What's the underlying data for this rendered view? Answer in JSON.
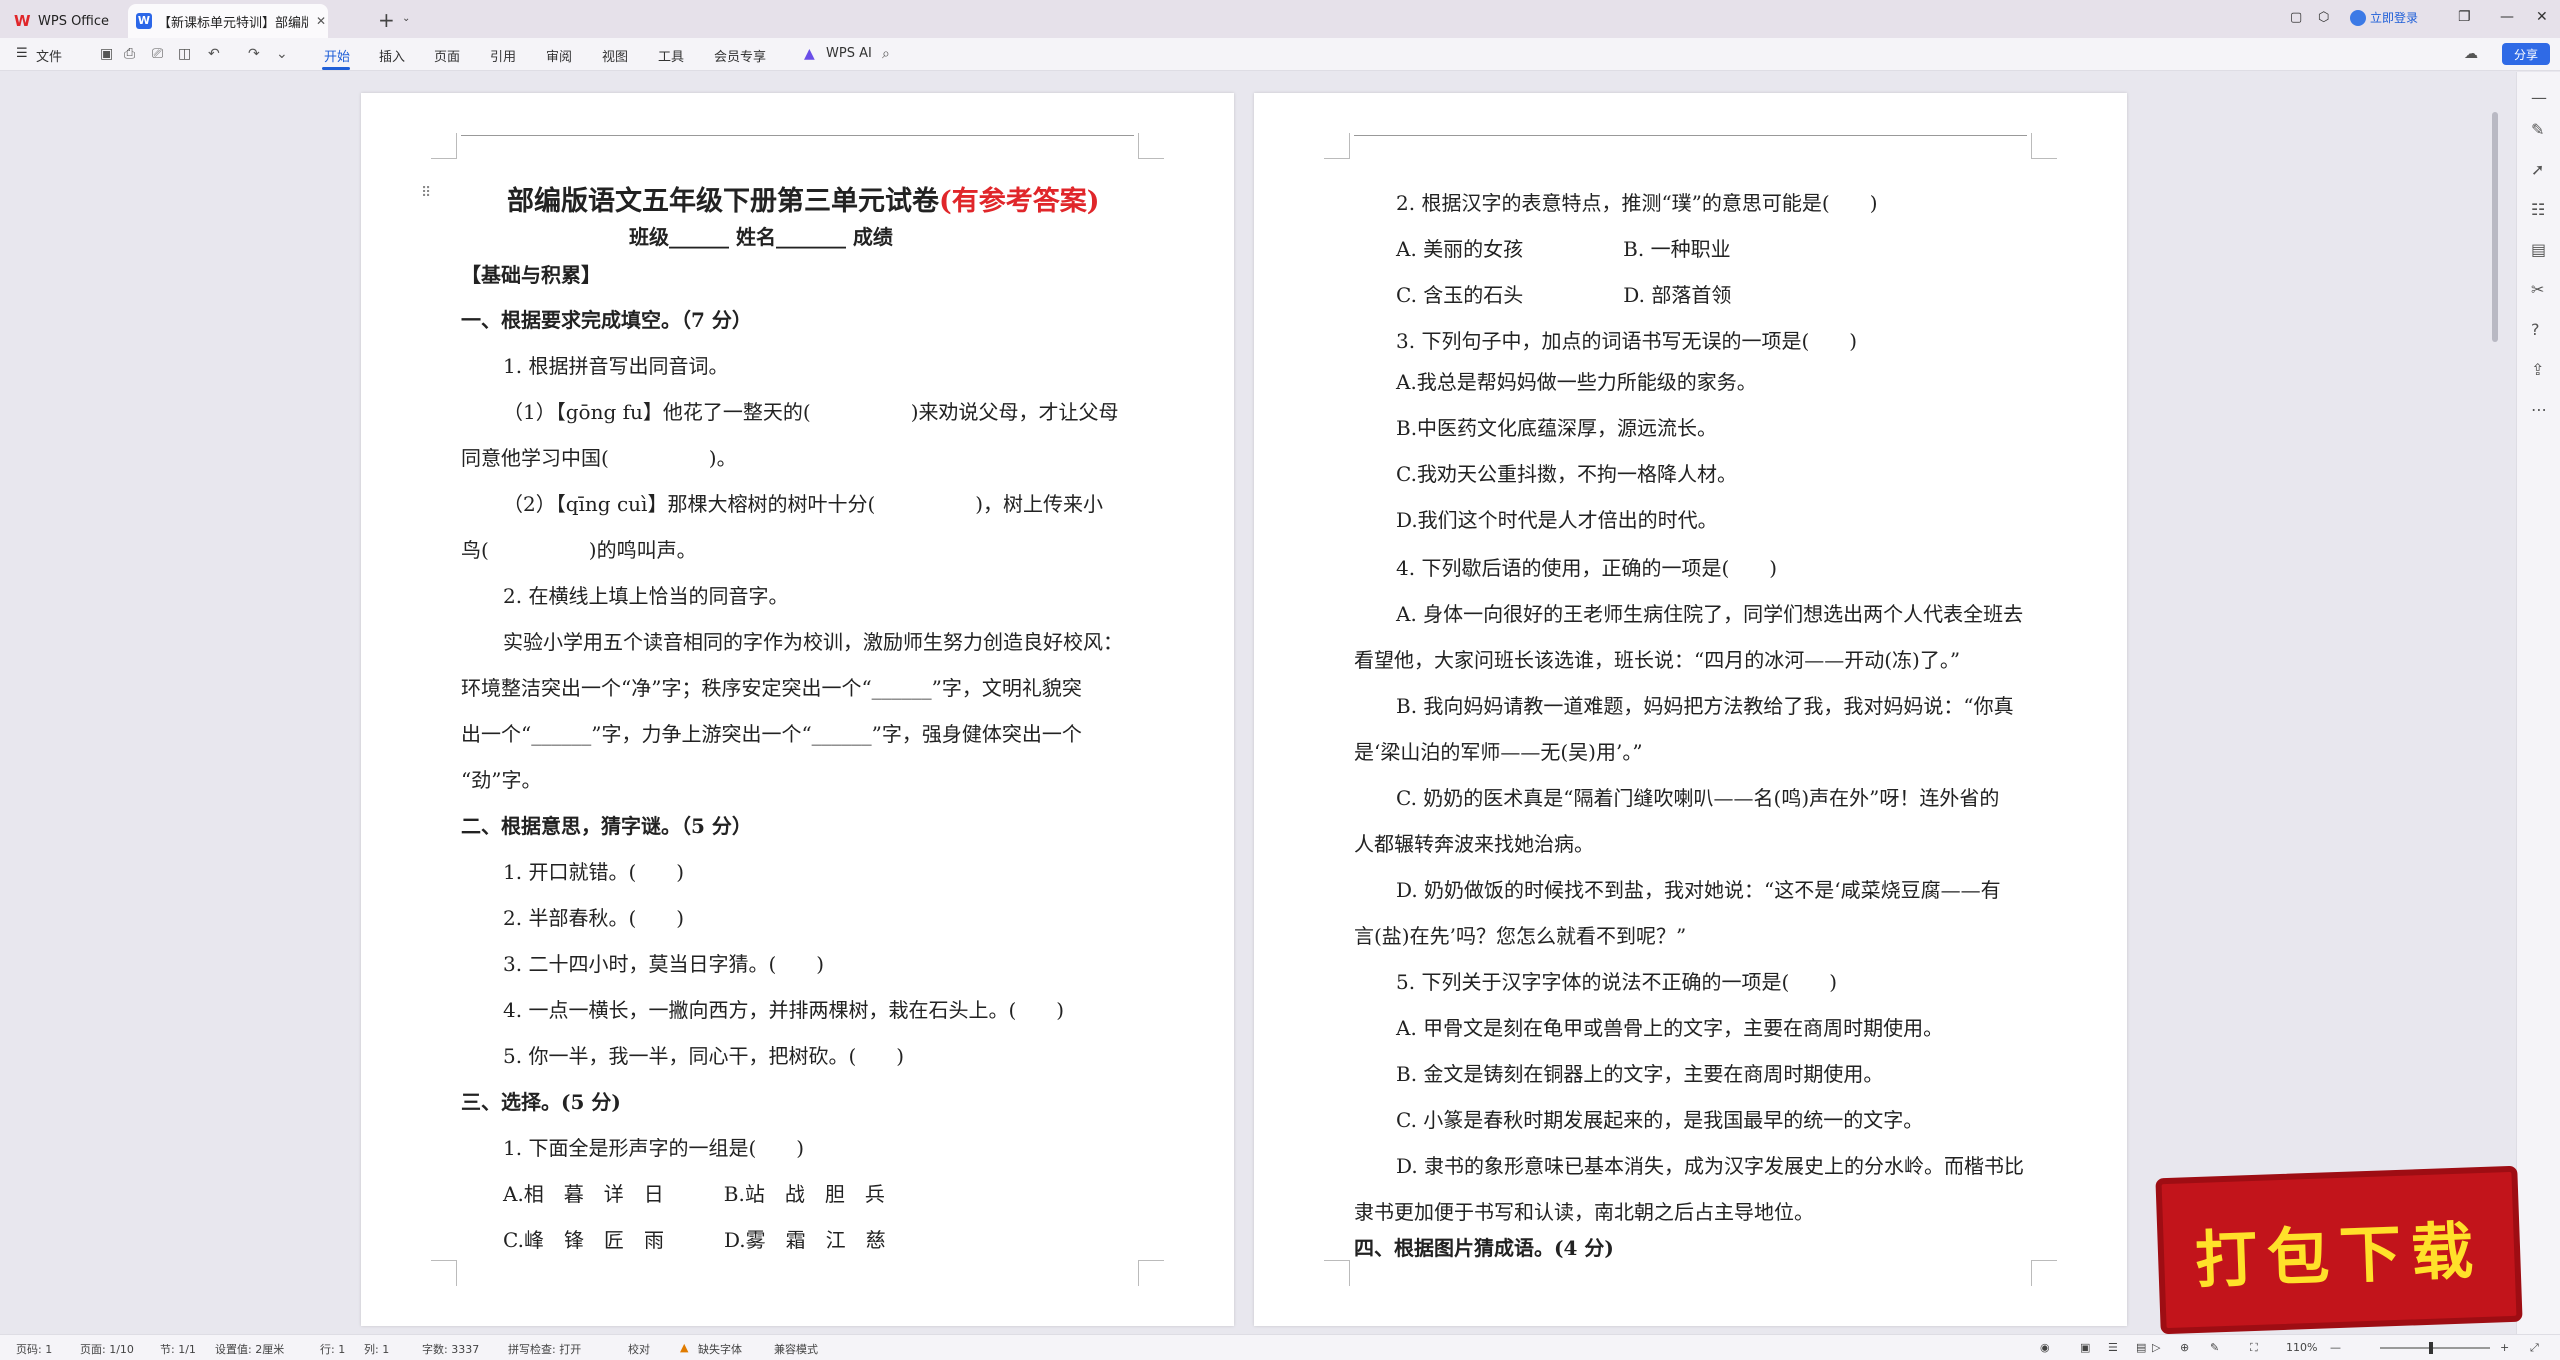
{
  "titlebar": {
    "app_tab": "WPS Office",
    "doc_tab": "【新课标单元特训】部编版语",
    "login": "立即登录"
  },
  "toolbar": {
    "file": "文件",
    "tabs": [
      "开始",
      "插入",
      "页面",
      "引用",
      "审阅",
      "视图",
      "工具",
      "会员专享"
    ],
    "ai": "WPS AI",
    "share": "分享"
  },
  "page1": {
    "title_main": "部编版语文五年级下册第三单元试卷",
    "title_red": "(有参考答案)",
    "subtitle": "班级______  姓名_______  成绩",
    "lines": [
      "【基础与积累】",
      "一、根据要求完成填空。（7 分）",
      "1. 根据拼音写出同音词。",
      "（1）【gōng fu】他花了一整天的(　　　　　)来劝说父母，才让父母",
      "同意他学习中国(　　　　　)。",
      "（2）【qīng cuì】那棵大榕树的树叶十分(　　　　　)，树上传来小",
      "鸟(　　　　　)的鸣叫声。",
      "2. 在横线上填上恰当的同音字。",
      "实验小学用五个读音相同的字作为校训，激励师生努力创造良好校风：",
      "环境整洁突出一个“净”字；秩序安定突出一个“______”字，文明礼貌突",
      "出一个“______”字，力争上游突出一个“______”字，强身健体突出一个",
      "“劲”字。",
      "二、根据意思，猜字谜。（5 分）",
      "1. 开口就错。(　　)",
      "2. 半部春秋。(　　)",
      "3. 二十四小时，莫当日字猜。(　　)",
      "4. 一点一横长，一撇向西方，并排两棵树，栽在石头上。(　　)",
      "5. 你一半，我一半，同心干，把树砍。(　　)",
      "三、选择。(5 分)",
      "1. 下面全是形声字的一组是(　　)",
      "A.相　暮　详　日　　　B.站　战　胆　兵",
      "C.峰　锋　匠　雨　　　D.雾　霜　江　慈"
    ]
  },
  "page2": {
    "lines": [
      "2. 根据汉字的表意特点，推测“璞”的意思可能是(　　)",
      "A. 美丽的女孩　　　　　B. 一种职业",
      "C. 含玉的石头　　　　　D. 部落首领",
      "3. 下列句子中，加点的词语书写无误的一项是(　　)",
      "A.我总是帮妈妈做一些力所能级的家务。",
      "B.中医药文化底蕴深厚，源远流长。",
      "C.我劝天公重抖擞，不拘一格降人材。",
      "D.我们这个时代是人才倍出的时代。",
      "4. 下列歇后语的使用，正确的一项是(　　)",
      "A. 身体一向很好的王老师生病住院了，同学们想选出两个人代表全班去",
      "看望他，大家问班长该选谁，班长说：“四月的冰河——开动(冻)了。”",
      "B. 我向妈妈请教一道难题，妈妈把方法教给了我，我对妈妈说：“你真",
      "是‘梁山泊的军师——无(吴)用’。”",
      "C. 奶奶的医术真是“隔着门缝吹喇叭——名(鸣)声在外”呀！连外省的",
      "人都辗转奔波来找她治病。",
      "D. 奶奶做饭的时候找不到盐，我对她说：“这不是‘咸菜烧豆腐——有",
      "言(盐)在先’吗？您怎么就看不到呢？”",
      "5. 下列关于汉字字体的说法不正确的一项是(　　)",
      "A. 甲骨文是刻在龟甲或兽骨上的文字，主要在商周时期使用。",
      "B. 金文是铸刻在铜器上的文字，主要在商周时期使用。",
      "C. 小篆是春秋时期发展起来的，是我国最早的统一的文字。",
      "D. 隶书的象形意味已基本消失，成为汉字发展史上的分水岭。而楷书比",
      "隶书更加便于书写和认读，南北朝之后占主导地位。",
      "四、根据图片猜成语。(4 分)"
    ]
  },
  "statusbar": {
    "page": "页码: 1",
    "pages": "页面: 1/10",
    "section": "节: 1/1",
    "setting": "设置值: 2厘米",
    "row": "行: 1",
    "col": "列: 1",
    "words": "字数: 3337",
    "spell": "拼写检查: 打开",
    "proof": "校对",
    "font_missing": "缺失字体",
    "compat": "兼容模式",
    "zoom": "110%"
  },
  "badge": "打包下载"
}
